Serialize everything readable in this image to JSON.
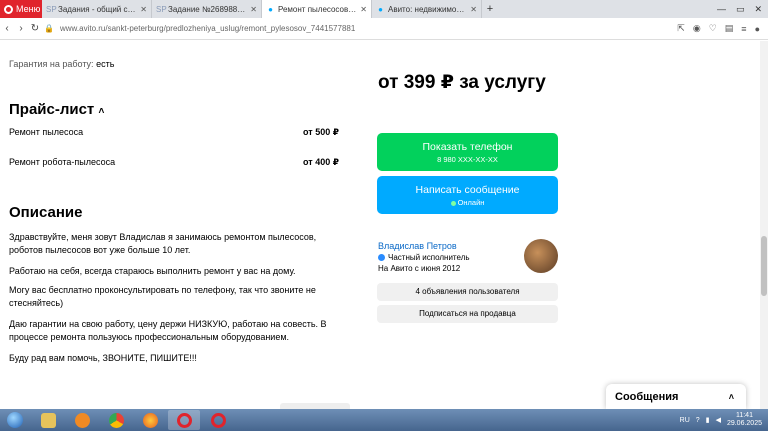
{
  "browser": {
    "menu_label": "Меню",
    "tabs": [
      {
        "title": "Задания - общий список",
        "icon": "SP",
        "active": false
      },
      {
        "title": "Задание №2689884 - пр",
        "icon": "SP",
        "active": false
      },
      {
        "title": "Ремонт пылесосов в Санк",
        "icon": "avito",
        "active": true
      },
      {
        "title": "Авито: недвижимость, тра",
        "icon": "avito",
        "active": false
      }
    ],
    "url": "www.avito.ru/sankt-peterburg/predlozheniya_uslug/remont_pylesosov_7441577881"
  },
  "listing": {
    "warranty_label": "Гарантия на работу:",
    "warranty_value": "есть",
    "price_heading": "от 399 ₽ за услугу",
    "pricelist_title": "Прайс-лист",
    "pricelist": [
      {
        "name": "Ремонт пылесоса",
        "price": "от 500 ₽"
      },
      {
        "name": "Ремонт робота-пылесоса",
        "price": "от 400 ₽"
      }
    ],
    "description_title": "Описание",
    "description": [
      "Здравствуйте, меня зовут Владислав я занимаюсь ремонтом пылесосов, роботов пылесосов вот уже больше 10 лет.",
      "Работаю на себя, всегда стараюсь выполнить ремонт у вас на дому.",
      "Могу вас бесплатно проконсультировать по телефону, так что звоните не стесняйтесь)",
      "Даю гарантии на свою работу, цену держи НИЗКУЮ, работаю на совесть. В процессе ремонта пользуюсь профессиональным оборудованием.",
      "Буду рад вам помочь, ЗВОНИТЕ, ПИШИТЕ!!!"
    ]
  },
  "actions": {
    "show_phone": "Показать телефон",
    "phone_masked": "8 980 XXX-XX-XX",
    "write_message": "Написать сообщение",
    "online": "Онлайн"
  },
  "seller": {
    "name": "Владислав Петров",
    "type": "Частный исполнитель",
    "since": "На Авито с июня 2012",
    "ads_button": "4 объявления пользователя",
    "subscribe_button": "Подписаться на продавца"
  },
  "messages_widget": {
    "title": "Сообщения"
  },
  "taskbar": {
    "lang": "RU",
    "time": "11:41",
    "date": "29.06.2025"
  },
  "colors": {
    "green": "#02d15c",
    "blue": "#00aaff",
    "opera_red": "#e0242c"
  }
}
